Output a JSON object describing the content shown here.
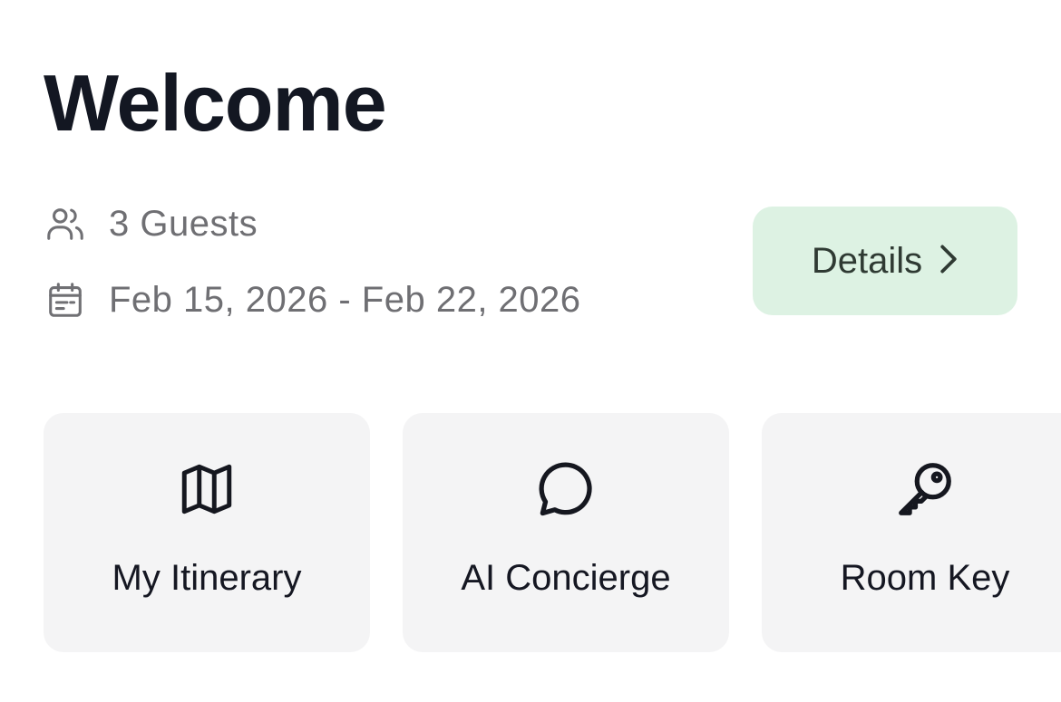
{
  "header": {
    "title": "Welcome"
  },
  "stay": {
    "guests": "3 Guests",
    "guests_icon": "users-icon",
    "dates": "Feb 15, 2026 - Feb 22, 2026",
    "dates_icon": "calendar-icon"
  },
  "details_button": {
    "label": "Details",
    "icon": "chevron-right-icon",
    "background": "#ddf2e3"
  },
  "quick_actions": [
    {
      "label": "My Itinerary",
      "icon": "map-icon"
    },
    {
      "label": "AI Concierge",
      "icon": "chat-bubble-icon"
    },
    {
      "label": "Room Key",
      "icon": "key-icon"
    }
  ],
  "colors": {
    "title": "#131722",
    "secondary_text": "#6f6f73",
    "card_background": "#f4f4f5"
  }
}
